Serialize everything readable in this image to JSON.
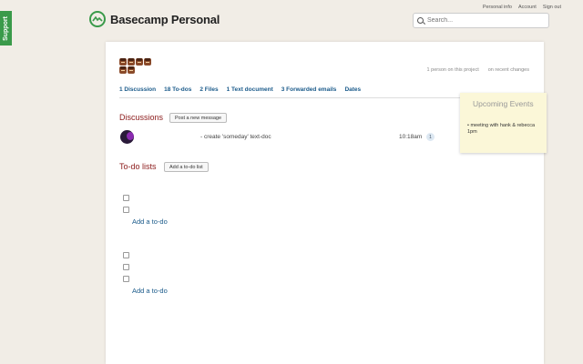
{
  "support": {
    "label": "Support"
  },
  "header": {
    "logo_text": "Basecamp Personal",
    "links": [
      "Personal info",
      "Account",
      "Sign out"
    ],
    "search_placeholder": "Search..."
  },
  "project": {
    "avatars_count": 6,
    "people_count": "1 person on this project",
    "recent_changes": "on recent changes"
  },
  "tabs": [
    "1 Discussion",
    "18 To-dos",
    "2 Files",
    "1 Text document",
    "3 Forwarded emails",
    "Dates"
  ],
  "discussions": {
    "title": "Discussions",
    "post_button": "Post a new message",
    "items": [
      {
        "title": "- create 'someday' text-doc",
        "time": "10:18am",
        "comments": "1"
      }
    ]
  },
  "todos": {
    "title": "To-do lists",
    "add_list_button": "Add a to-do list",
    "lists": [
      {
        "checkboxes": 2,
        "add_label": "Add a to-do"
      },
      {
        "checkboxes": 3,
        "add_label": "Add a to-do"
      }
    ]
  },
  "events": {
    "title": "Upcoming Events",
    "items": [
      "meeting with hank & rebecca 1pm"
    ]
  },
  "colors": {
    "accent_green": "#3a9a4a",
    "section_red": "#8b1a1a",
    "link_blue": "#1a5a8a"
  }
}
